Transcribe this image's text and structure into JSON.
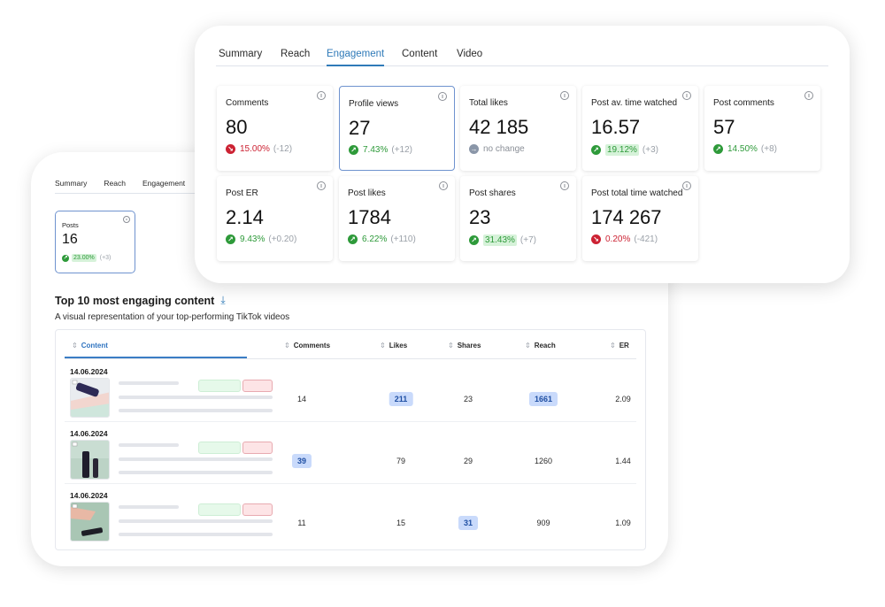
{
  "colors": {
    "accent": "#2f7ab8",
    "positive": "#2e9a3a",
    "negative": "#cc2233",
    "neutral": "#8a96a8",
    "highlight_cell": "#c9dafb",
    "positive_highlight": "#d6f2d9"
  },
  "front": {
    "tabs": [
      {
        "label": "Summary",
        "active": false
      },
      {
        "label": "Reach",
        "active": false
      },
      {
        "label": "Engagement",
        "active": true
      },
      {
        "label": "Content",
        "active": false
      },
      {
        "label": "Video",
        "active": false
      }
    ],
    "kpis": [
      {
        "title": "Comments",
        "value": "80",
        "trend": "down",
        "pct": "15.00%",
        "abs": "(-12)",
        "selected": false,
        "highlight": false
      },
      {
        "title": "Profile views",
        "value": "27",
        "trend": "up",
        "pct": "7.43%",
        "abs": "(+12)",
        "selected": true,
        "highlight": false
      },
      {
        "title": "Total likes",
        "value": "42 185",
        "trend": "none",
        "pct": "no change",
        "abs": "",
        "selected": false,
        "highlight": false
      },
      {
        "title": "Post av. time watched",
        "value": "16.57",
        "trend": "up",
        "pct": "19.12%",
        "abs": "(+3)",
        "selected": false,
        "highlight": true
      },
      {
        "title": "Post comments",
        "value": "57",
        "trend": "up",
        "pct": "14.50%",
        "abs": "(+8)",
        "selected": false,
        "highlight": false
      },
      {
        "title": "Post ER",
        "value": "2.14",
        "trend": "up",
        "pct": "9.43%",
        "abs": "(+0.20)",
        "selected": false,
        "highlight": false
      },
      {
        "title": "Post likes",
        "value": "1784",
        "trend": "up",
        "pct": "6.22%",
        "abs": "(+110)",
        "selected": false,
        "highlight": false
      },
      {
        "title": "Post shares",
        "value": "23",
        "trend": "up",
        "pct": "31.43%",
        "abs": "(+7)",
        "selected": false,
        "highlight": true
      },
      {
        "title": "Post total time watched",
        "value": "174 267",
        "trend": "down",
        "pct": "0.20%",
        "abs": "(-421)",
        "selected": false,
        "highlight": false
      }
    ]
  },
  "back": {
    "tabs": [
      {
        "label": "Summary"
      },
      {
        "label": "Reach"
      },
      {
        "label": "Engagement"
      }
    ],
    "posts_card": {
      "title": "Posts",
      "value": "16",
      "trend": "up",
      "pct": "23.00%",
      "abs": "(+3)"
    },
    "section": {
      "title": "Top 10 most engaging content",
      "subtitle": "A visual representation of your top-performing TikTok videos"
    },
    "table": {
      "columns": [
        {
          "label": "Content",
          "active": true
        },
        {
          "label": "Comments",
          "active": false
        },
        {
          "label": "Likes",
          "active": false
        },
        {
          "label": "Shares",
          "active": false
        },
        {
          "label": "Reach",
          "active": false
        },
        {
          "label": "ER",
          "active": false
        }
      ],
      "rows": [
        {
          "date": "14.06.2024",
          "thumb": "purple-tube-product",
          "comments": "14",
          "likes": "211",
          "shares": "23",
          "reach": "1661",
          "er": "2.09",
          "highlight": [
            "likes",
            "reach"
          ]
        },
        {
          "date": "14.06.2024",
          "thumb": "black-bottles-product",
          "comments": "39",
          "likes": "79",
          "shares": "29",
          "reach": "1260",
          "er": "1.44",
          "highlight": [
            "comments"
          ]
        },
        {
          "date": "14.06.2024",
          "thumb": "hand-with-product",
          "comments": "11",
          "likes": "15",
          "shares": "31",
          "reach": "909",
          "er": "1.09",
          "highlight": [
            "shares"
          ]
        }
      ]
    }
  },
  "icons": {
    "up": "↗",
    "down": "↘",
    "none": "→",
    "sort": "⇕",
    "download": "⤓"
  }
}
